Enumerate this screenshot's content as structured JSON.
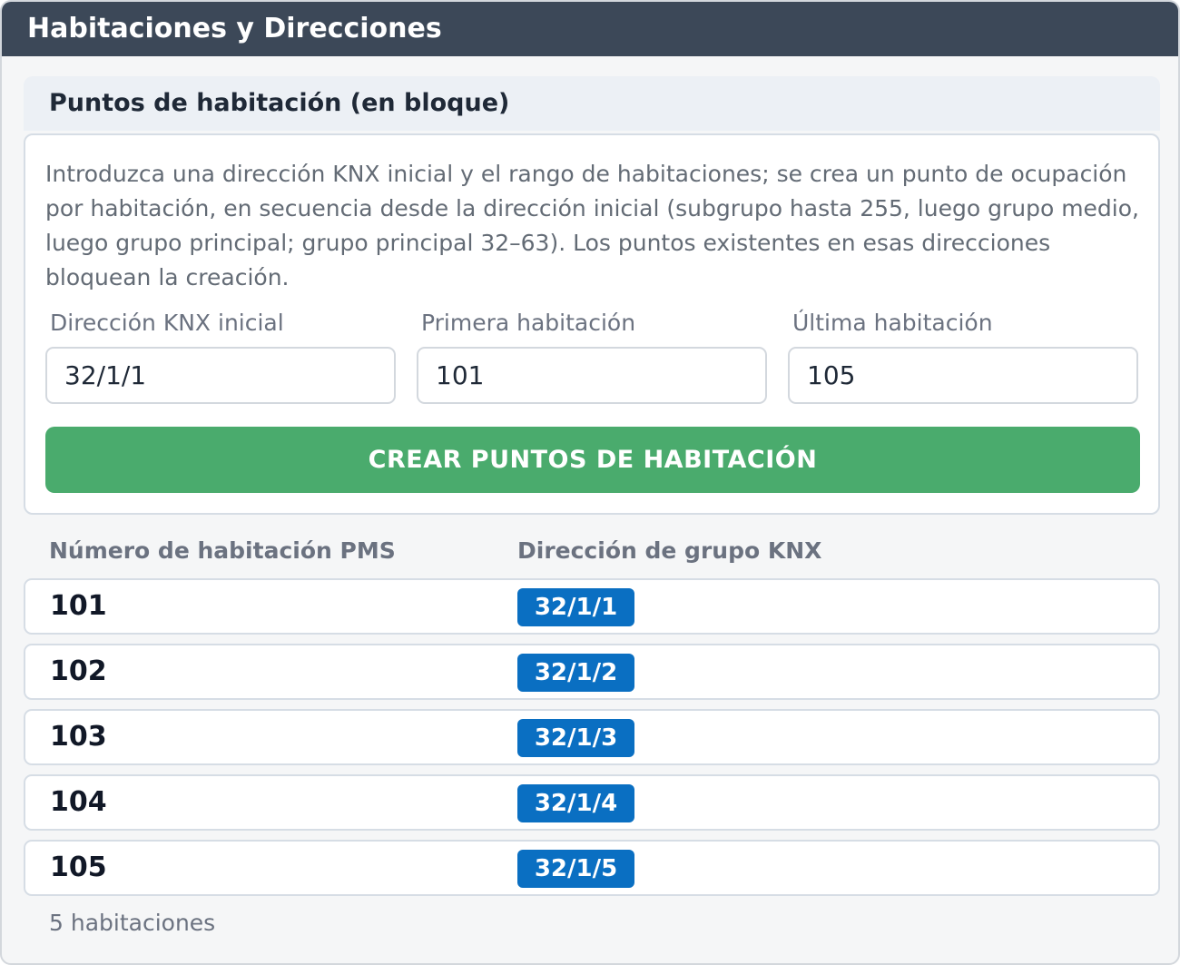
{
  "window": {
    "title": "Habitaciones y Direcciones"
  },
  "panel": {
    "title": "Puntos de habitación (en bloque)",
    "description": "Introduzca una dirección KNX inicial y el rango de habitaciones; se crea un punto de ocupación por habitación, en secuencia desde la dirección inicial (subgrupo hasta 255, luego grupo medio, luego grupo principal; grupo principal 32–63). Los puntos existentes en esas direcciones bloquean la creación."
  },
  "form": {
    "start_address": {
      "label": "Dirección KNX inicial",
      "value": "32/1/1"
    },
    "first_room": {
      "label": "Primera habitación",
      "value": "101"
    },
    "last_room": {
      "label": "Última habitación",
      "value": "105"
    },
    "create_button": "CREAR PUNTOS DE HABITACIÓN"
  },
  "table": {
    "headers": [
      "Número de habitación PMS",
      "Dirección de grupo KNX"
    ],
    "rows": [
      {
        "room": "101",
        "address": "32/1/1"
      },
      {
        "room": "102",
        "address": "32/1/2"
      },
      {
        "room": "103",
        "address": "32/1/3"
      },
      {
        "room": "104",
        "address": "32/1/4"
      },
      {
        "room": "105",
        "address": "32/1/5"
      }
    ],
    "count_label": "5 habitaciones"
  },
  "colors": {
    "titlebar": "#3c4858",
    "create_button": "#4aab6d",
    "address_badge": "#0a6fc2"
  }
}
